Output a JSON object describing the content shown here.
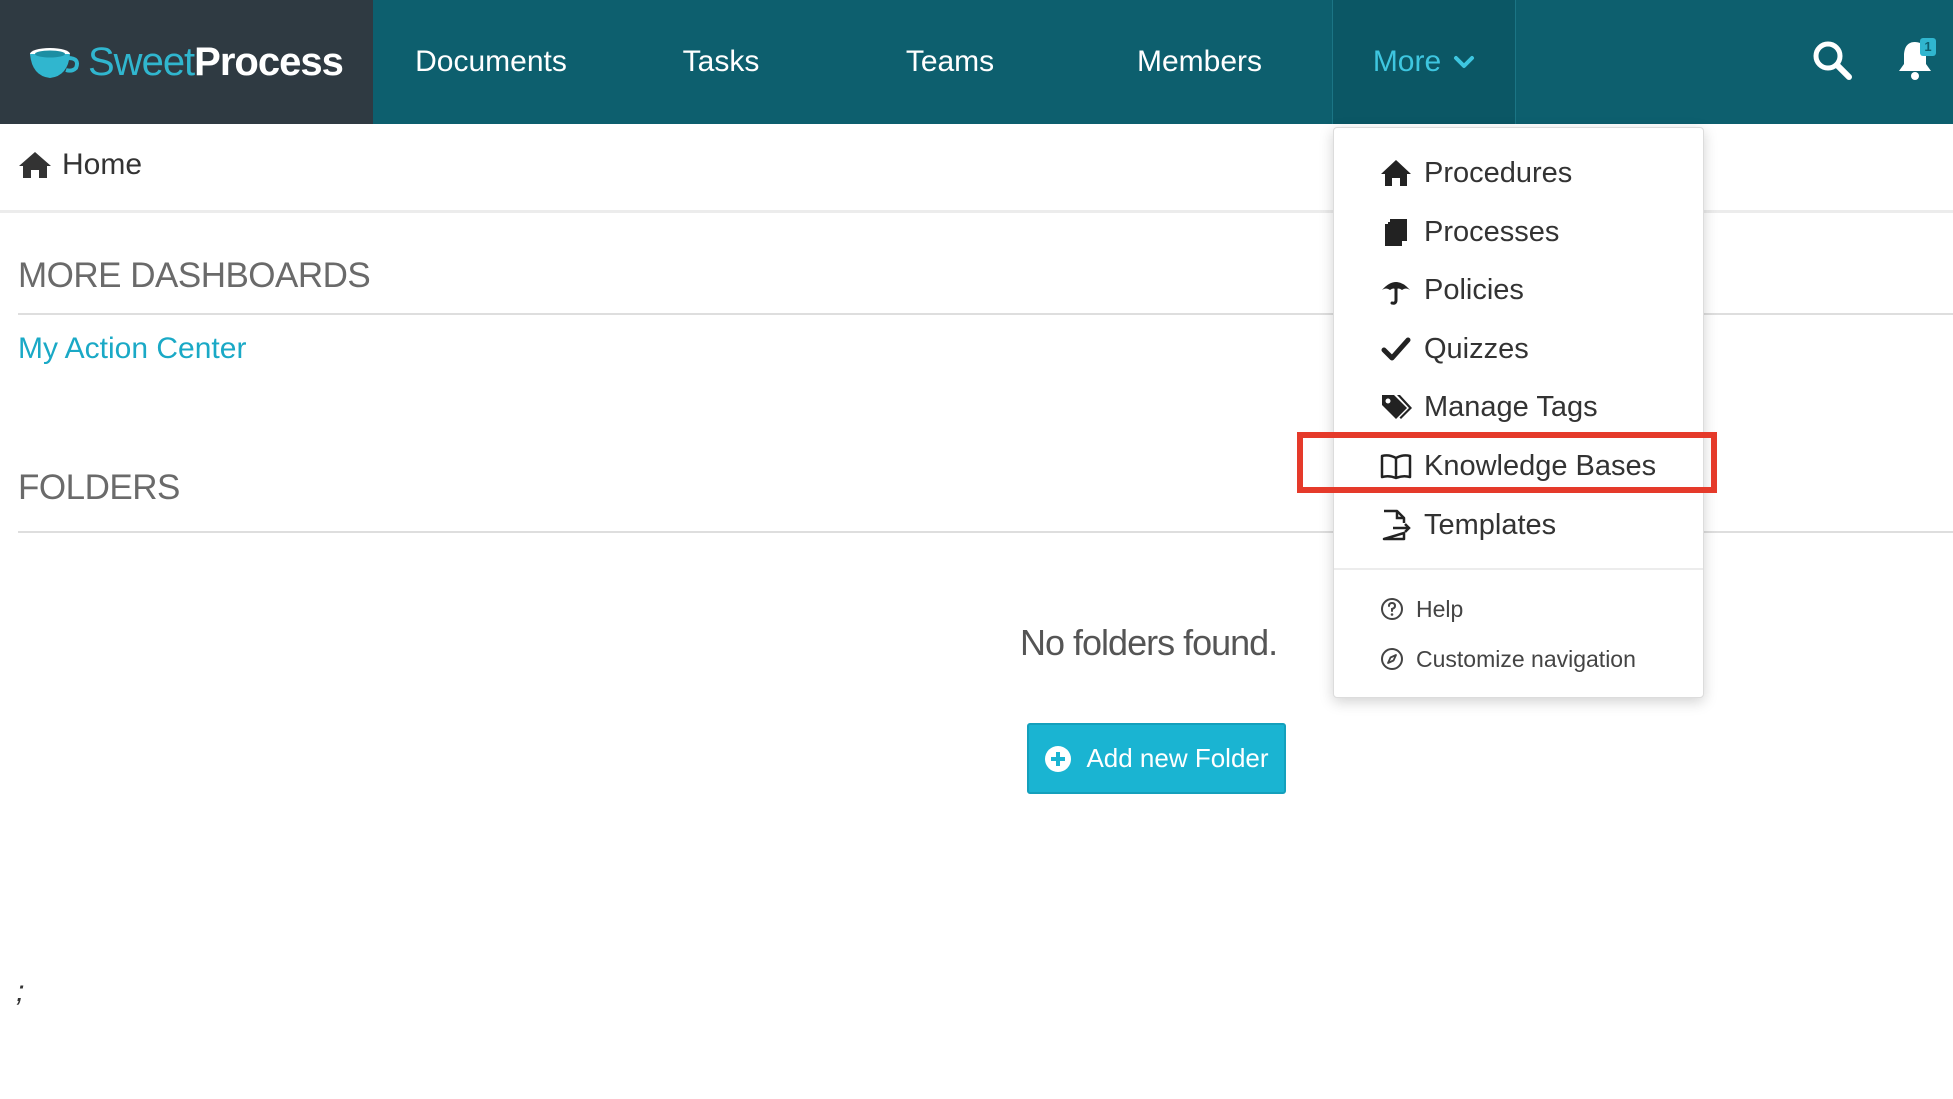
{
  "app": {
    "brand_sweet": "Sweet",
    "brand_process": "Process",
    "colors": {
      "nav_bg": "#0d5f6e",
      "brand_bg": "#2f3a42",
      "accent": "#1ab4d2",
      "link": "#1aa9c6",
      "highlight": "#e53a2a"
    }
  },
  "nav": {
    "documents": "Documents",
    "tasks": "Tasks",
    "teams": "Teams",
    "members": "Members",
    "more": "More",
    "notification_count": "1"
  },
  "breadcrumb": {
    "home": "Home"
  },
  "main": {
    "dashboards_heading": "MORE DASHBOARDS",
    "action_center_link": "My Action Center",
    "folders_heading": "FOLDERS",
    "empty_message": "No folders found.",
    "add_folder_button": "Add new Folder",
    "stray_text": ";"
  },
  "more_menu": {
    "items": [
      {
        "label": "Procedures",
        "icon": "home-icon"
      },
      {
        "label": "Processes",
        "icon": "documents-icon"
      },
      {
        "label": "Policies",
        "icon": "umbrella-icon"
      },
      {
        "label": "Quizzes",
        "icon": "check-icon"
      },
      {
        "label": "Manage Tags",
        "icon": "tags-icon"
      },
      {
        "label": "Knowledge Bases",
        "icon": "book-icon",
        "highlighted": true
      },
      {
        "label": "Templates",
        "icon": "file-export-icon"
      }
    ],
    "help": "Help",
    "customize": "Customize navigation"
  }
}
